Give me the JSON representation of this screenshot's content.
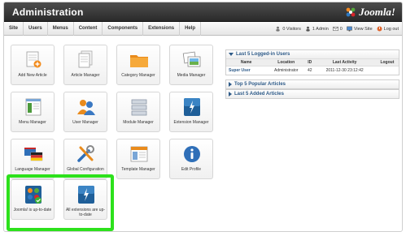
{
  "header": {
    "title": "Administration",
    "logo_text": "Joomla!"
  },
  "menu": [
    "Site",
    "Users",
    "Menus",
    "Content",
    "Components",
    "Extensions",
    "Help"
  ],
  "status": {
    "visitors": "0 Visitors",
    "admin": "1 Admin",
    "messages": "0",
    "view_site": "View Site",
    "logout": "Log out"
  },
  "quickicons": [
    {
      "label": "Add New Article",
      "icon": "add-article-icon"
    },
    {
      "label": "Article Manager",
      "icon": "article-manager-icon"
    },
    {
      "label": "Category Manager",
      "icon": "category-folder-icon"
    },
    {
      "label": "Media Manager",
      "icon": "media-images-icon"
    },
    {
      "label": "Menu Manager",
      "icon": "menu-manager-icon"
    },
    {
      "label": "User Manager",
      "icon": "users-icon"
    },
    {
      "label": "Module Manager",
      "icon": "module-manager-icon"
    },
    {
      "label": "Extension Manager",
      "icon": "extension-bolt-icon"
    },
    {
      "label": "Language Manager",
      "icon": "language-icon"
    },
    {
      "label": "Global Configuration",
      "icon": "tools-icon"
    },
    {
      "label": "Template Manager",
      "icon": "template-icon"
    },
    {
      "label": "Edit Profile",
      "icon": "info-icon"
    },
    {
      "label": "Joomla! is up-to-date",
      "icon": "joomla-check-icon"
    },
    {
      "label": "All extensions are up-to-date",
      "icon": "extension-bolt-icon"
    }
  ],
  "panels": {
    "logged_in": {
      "title": "Last 5 Logged-in Users",
      "columns": [
        "Name",
        "Location",
        "ID",
        "Last Activity",
        "Logout"
      ],
      "rows": [
        {
          "name": "Super User",
          "location": "Administrator",
          "id": "42",
          "activity": "2011-12-30 23:12:42",
          "logout": ""
        }
      ]
    },
    "popular": {
      "title": "Top 5 Popular Articles"
    },
    "added": {
      "title": "Last 5 Added Articles"
    }
  },
  "colors": {
    "header": "#333333",
    "link": "#2d5a88",
    "highlight": "#2de11c"
  }
}
